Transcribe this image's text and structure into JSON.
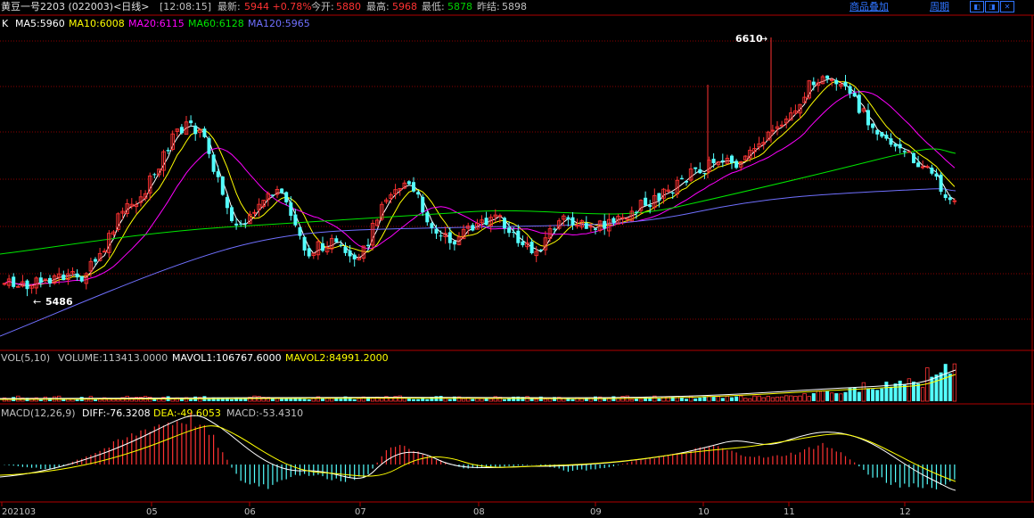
{
  "header": {
    "instrument": "黄豆一号2203 (022003)<日线>",
    "time": "[12:08:15]",
    "latest_label": "最新:",
    "latest_value": "5944 +0.78%",
    "open_label": "今开:",
    "open_value": "5880",
    "high_label": "最高:",
    "high_value": "5968",
    "low_label": "最低:",
    "low_value": "5878",
    "prev_settle_label": "昨结:",
    "prev_settle_value": "5898",
    "overlay_button": "商品叠加",
    "period_button": "周期",
    "window_buttons": [
      "restore-left-icon",
      "restore-right-icon",
      "close-icon"
    ]
  },
  "price_legend": {
    "k_label": "K",
    "ma5": "MA5:5960",
    "ma10": "MA10:6008",
    "ma20": "MA20:6115",
    "ma60": "MA60:6128",
    "ma120": "MA120:5965"
  },
  "volume_legend": {
    "vol": "VOL(5,10)",
    "volume": "VOLUME:113413.0000",
    "mavol1": "MAVOL1:106767.6000",
    "mavol2": "MAVOL2:84991.2000"
  },
  "macd_legend": {
    "macd": "MACD(12,26,9)",
    "diff": "DIFF:-76.3208",
    "dea": "DEA:-49.6053",
    "macd_val": "MACD:-53.4310"
  },
  "annotations": {
    "high_marker": "6610",
    "low_marker": "5486"
  },
  "x_axis_labels": [
    "202103",
    "05",
    "06",
    "07",
    "08",
    "09",
    "10",
    "11",
    "12"
  ],
  "colors": {
    "up": "#ff3232",
    "down": "#54ffff",
    "ma5": "#ffffff",
    "ma10": "#ffff00",
    "ma20": "#ff00ff",
    "ma60": "#00e600",
    "ma120": "#7070ff",
    "grid": "#8b0000",
    "blue_text": "#2f74ff"
  },
  "chart_data": {
    "type": "candlestick",
    "price_range": [
      5486,
      6610
    ],
    "series_names": [
      "MA5",
      "MA10",
      "MA20",
      "MA60",
      "MA120"
    ],
    "macd_histogram": "red above zero, cyan below zero"
  }
}
